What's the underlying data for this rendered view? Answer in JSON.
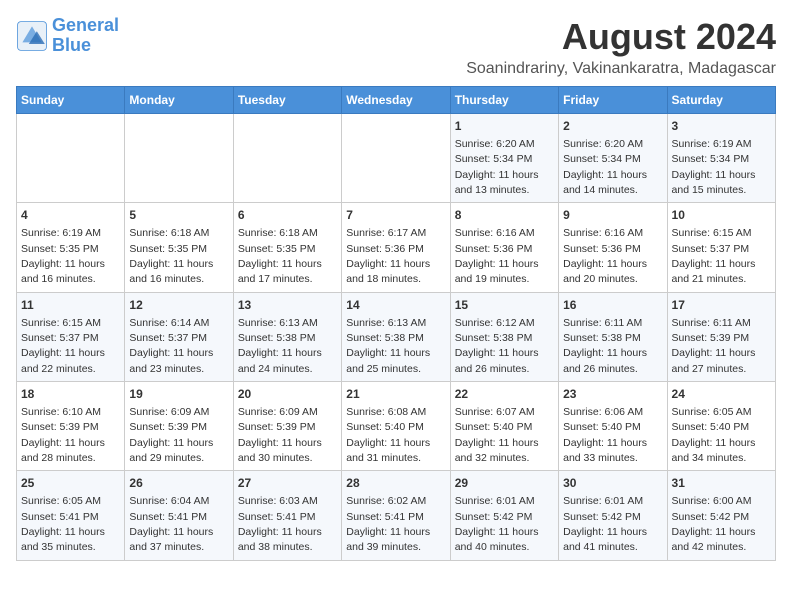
{
  "logo": {
    "line1": "General",
    "line2": "Blue"
  },
  "title": "August 2024",
  "subtitle": "Soanindrariny, Vakinankaratra, Madagascar",
  "weekdays": [
    "Sunday",
    "Monday",
    "Tuesday",
    "Wednesday",
    "Thursday",
    "Friday",
    "Saturday"
  ],
  "weeks": [
    [
      {
        "day": "",
        "info": ""
      },
      {
        "day": "",
        "info": ""
      },
      {
        "day": "",
        "info": ""
      },
      {
        "day": "",
        "info": ""
      },
      {
        "day": "1",
        "info": "Sunrise: 6:20 AM\nSunset: 5:34 PM\nDaylight: 11 hours\nand 13 minutes."
      },
      {
        "day": "2",
        "info": "Sunrise: 6:20 AM\nSunset: 5:34 PM\nDaylight: 11 hours\nand 14 minutes."
      },
      {
        "day": "3",
        "info": "Sunrise: 6:19 AM\nSunset: 5:34 PM\nDaylight: 11 hours\nand 15 minutes."
      }
    ],
    [
      {
        "day": "4",
        "info": "Sunrise: 6:19 AM\nSunset: 5:35 PM\nDaylight: 11 hours\nand 16 minutes."
      },
      {
        "day": "5",
        "info": "Sunrise: 6:18 AM\nSunset: 5:35 PM\nDaylight: 11 hours\nand 16 minutes."
      },
      {
        "day": "6",
        "info": "Sunrise: 6:18 AM\nSunset: 5:35 PM\nDaylight: 11 hours\nand 17 minutes."
      },
      {
        "day": "7",
        "info": "Sunrise: 6:17 AM\nSunset: 5:36 PM\nDaylight: 11 hours\nand 18 minutes."
      },
      {
        "day": "8",
        "info": "Sunrise: 6:16 AM\nSunset: 5:36 PM\nDaylight: 11 hours\nand 19 minutes."
      },
      {
        "day": "9",
        "info": "Sunrise: 6:16 AM\nSunset: 5:36 PM\nDaylight: 11 hours\nand 20 minutes."
      },
      {
        "day": "10",
        "info": "Sunrise: 6:15 AM\nSunset: 5:37 PM\nDaylight: 11 hours\nand 21 minutes."
      }
    ],
    [
      {
        "day": "11",
        "info": "Sunrise: 6:15 AM\nSunset: 5:37 PM\nDaylight: 11 hours\nand 22 minutes."
      },
      {
        "day": "12",
        "info": "Sunrise: 6:14 AM\nSunset: 5:37 PM\nDaylight: 11 hours\nand 23 minutes."
      },
      {
        "day": "13",
        "info": "Sunrise: 6:13 AM\nSunset: 5:38 PM\nDaylight: 11 hours\nand 24 minutes."
      },
      {
        "day": "14",
        "info": "Sunrise: 6:13 AM\nSunset: 5:38 PM\nDaylight: 11 hours\nand 25 minutes."
      },
      {
        "day": "15",
        "info": "Sunrise: 6:12 AM\nSunset: 5:38 PM\nDaylight: 11 hours\nand 26 minutes."
      },
      {
        "day": "16",
        "info": "Sunrise: 6:11 AM\nSunset: 5:38 PM\nDaylight: 11 hours\nand 26 minutes."
      },
      {
        "day": "17",
        "info": "Sunrise: 6:11 AM\nSunset: 5:39 PM\nDaylight: 11 hours\nand 27 minutes."
      }
    ],
    [
      {
        "day": "18",
        "info": "Sunrise: 6:10 AM\nSunset: 5:39 PM\nDaylight: 11 hours\nand 28 minutes."
      },
      {
        "day": "19",
        "info": "Sunrise: 6:09 AM\nSunset: 5:39 PM\nDaylight: 11 hours\nand 29 minutes."
      },
      {
        "day": "20",
        "info": "Sunrise: 6:09 AM\nSunset: 5:39 PM\nDaylight: 11 hours\nand 30 minutes."
      },
      {
        "day": "21",
        "info": "Sunrise: 6:08 AM\nSunset: 5:40 PM\nDaylight: 11 hours\nand 31 minutes."
      },
      {
        "day": "22",
        "info": "Sunrise: 6:07 AM\nSunset: 5:40 PM\nDaylight: 11 hours\nand 32 minutes."
      },
      {
        "day": "23",
        "info": "Sunrise: 6:06 AM\nSunset: 5:40 PM\nDaylight: 11 hours\nand 33 minutes."
      },
      {
        "day": "24",
        "info": "Sunrise: 6:05 AM\nSunset: 5:40 PM\nDaylight: 11 hours\nand 34 minutes."
      }
    ],
    [
      {
        "day": "25",
        "info": "Sunrise: 6:05 AM\nSunset: 5:41 PM\nDaylight: 11 hours\nand 35 minutes."
      },
      {
        "day": "26",
        "info": "Sunrise: 6:04 AM\nSunset: 5:41 PM\nDaylight: 11 hours\nand 37 minutes."
      },
      {
        "day": "27",
        "info": "Sunrise: 6:03 AM\nSunset: 5:41 PM\nDaylight: 11 hours\nand 38 minutes."
      },
      {
        "day": "28",
        "info": "Sunrise: 6:02 AM\nSunset: 5:41 PM\nDaylight: 11 hours\nand 39 minutes."
      },
      {
        "day": "29",
        "info": "Sunrise: 6:01 AM\nSunset: 5:42 PM\nDaylight: 11 hours\nand 40 minutes."
      },
      {
        "day": "30",
        "info": "Sunrise: 6:01 AM\nSunset: 5:42 PM\nDaylight: 11 hours\nand 41 minutes."
      },
      {
        "day": "31",
        "info": "Sunrise: 6:00 AM\nSunset: 5:42 PM\nDaylight: 11 hours\nand 42 minutes."
      }
    ]
  ]
}
